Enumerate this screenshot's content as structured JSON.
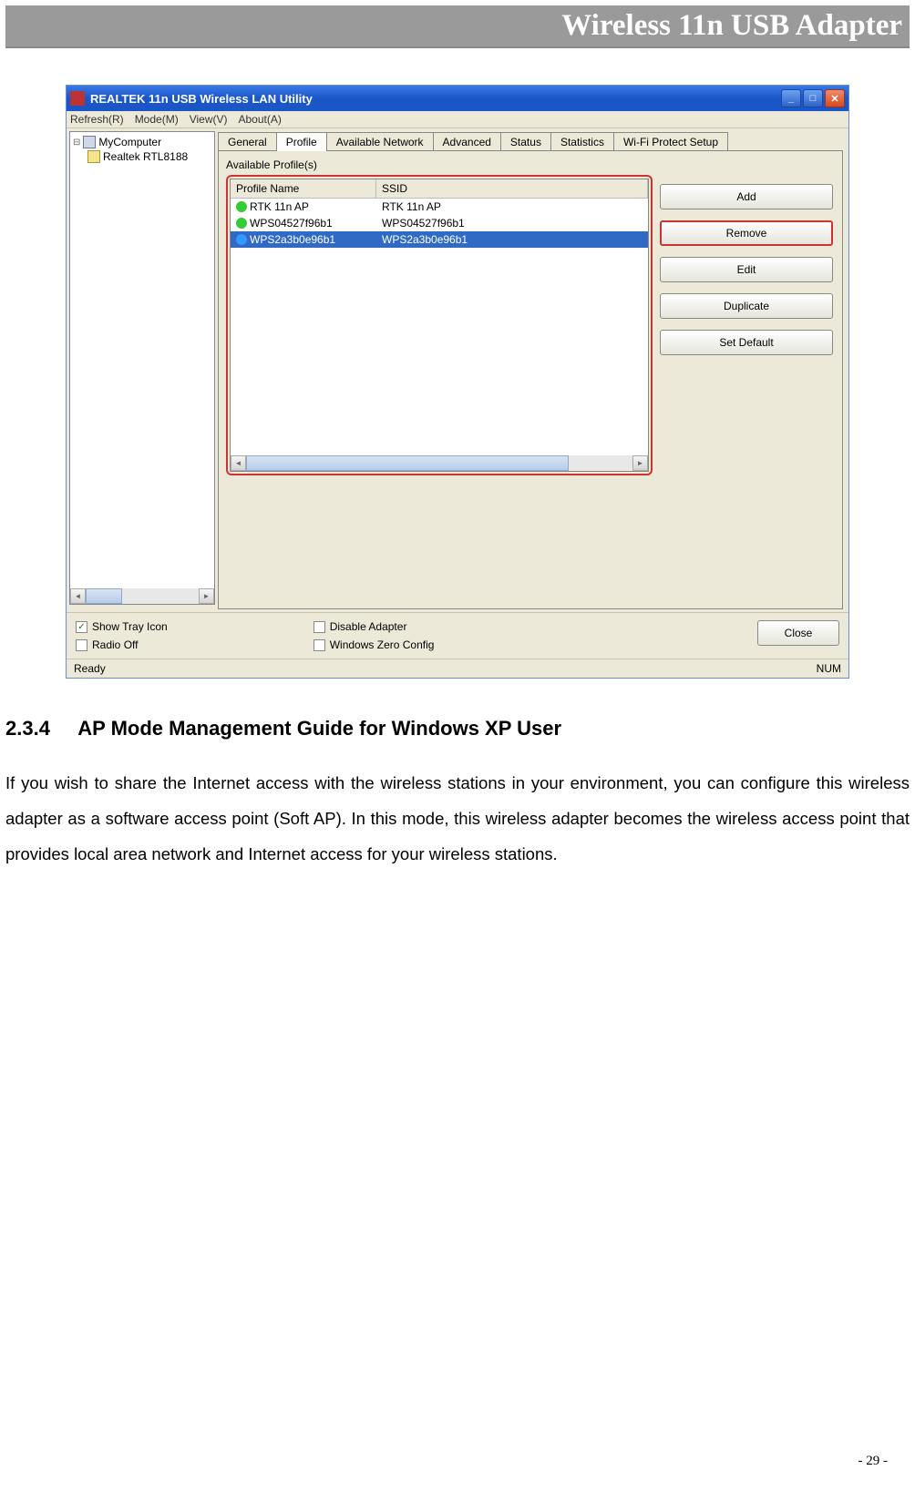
{
  "doc": {
    "header_title": "Wireless 11n USB Adapter",
    "section_number": "2.3.4",
    "section_title": "AP Mode Management Guide for Windows XP User",
    "paragraph": "If you wish to share the Internet access with the wireless stations in your environment, you can configure this wireless adapter as a software access point (Soft AP). In this mode, this wireless adapter becomes the wireless access point that provides local area network and Internet access for your wireless stations.",
    "page_number": "- 29 -"
  },
  "app": {
    "title": "REALTEK 11n USB Wireless LAN Utility",
    "menus": [
      "Refresh(R)",
      "Mode(M)",
      "View(V)",
      "About(A)"
    ],
    "tree": {
      "root": "MyComputer",
      "child": "Realtek RTL8188"
    },
    "tabs": [
      "General",
      "Profile",
      "Available Network",
      "Advanced",
      "Status",
      "Statistics",
      "Wi-Fi Protect Setup"
    ],
    "active_tab": "Profile",
    "profiles_label": "Available Profile(s)",
    "columns": {
      "name": "Profile Name",
      "ssid": "SSID"
    },
    "rows": [
      {
        "name": "RTK 11n AP",
        "ssid": "RTK 11n AP",
        "icon": "green",
        "selected": false
      },
      {
        "name": "WPS04527f96b1",
        "ssid": "WPS04527f96b1",
        "icon": "green",
        "selected": false
      },
      {
        "name": "WPS2a3b0e96b1",
        "ssid": "WPS2a3b0e96b1",
        "icon": "blue",
        "selected": true
      }
    ],
    "buttons": {
      "add": "Add",
      "remove": "Remove",
      "edit": "Edit",
      "duplicate": "Duplicate",
      "set_default": "Set Default",
      "close": "Close"
    },
    "options": {
      "show_tray": "Show Tray Icon",
      "radio_off": "Radio Off",
      "disable_adapter": "Disable Adapter",
      "win_zero": "Windows Zero Config"
    },
    "checks": {
      "show_tray": true,
      "radio_off": false,
      "disable_adapter": false,
      "win_zero": false
    },
    "status": {
      "left": "Ready",
      "right": "NUM"
    }
  }
}
